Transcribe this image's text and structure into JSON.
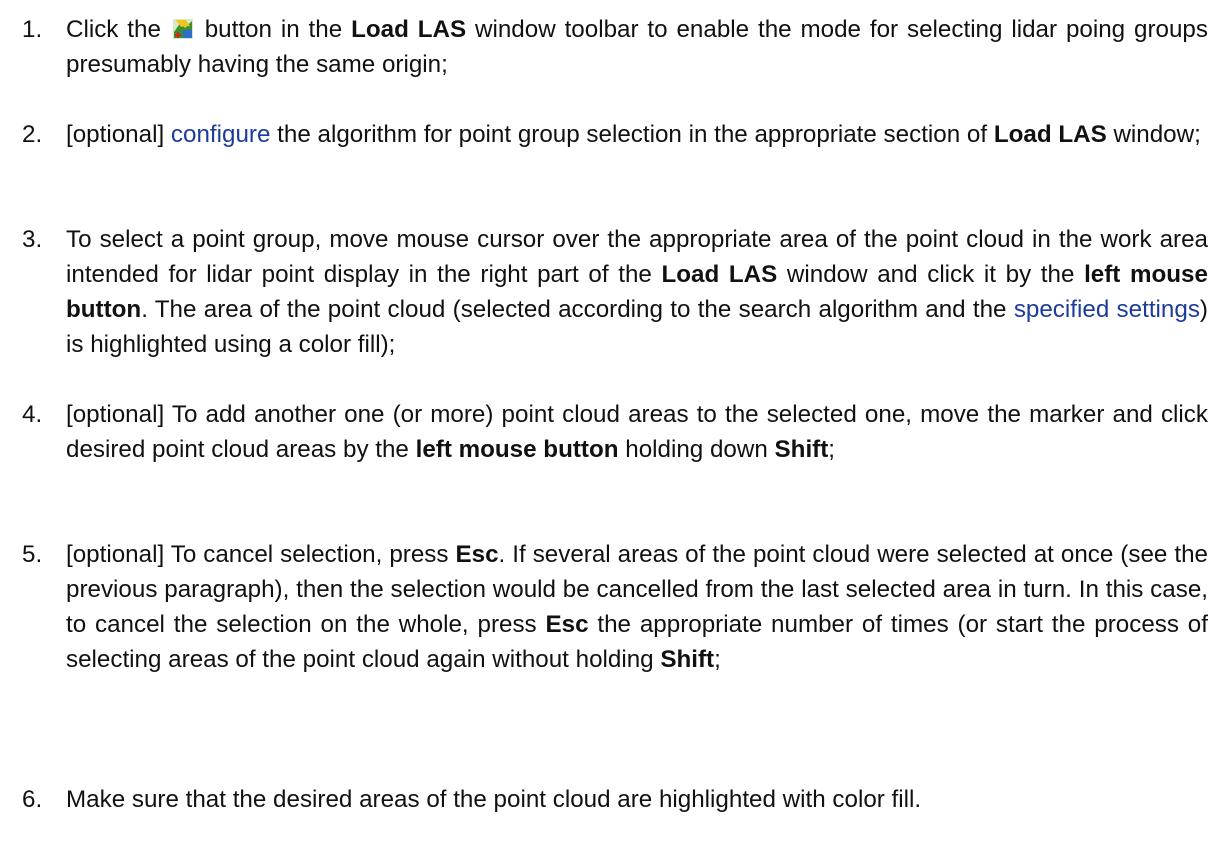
{
  "steps": [
    {
      "number": "1.",
      "parts": {
        "a": "Click the",
        "b": "button in the",
        "c": "Load LAS",
        "d": "window toolbar to enable the mode for selecting lidar poing groups presumably having the same origin;"
      },
      "icon": "select-point-group-toolbar-icon"
    },
    {
      "number": "2.",
      "parts": {
        "a": "[optional]",
        "link": "configure",
        "b": "the algorithm for point group selection in the appropriate section of",
        "c": "Load LAS",
        "d": "window;"
      }
    },
    {
      "number": "3.",
      "parts": {
        "a": "To select a point group, move mouse cursor over the appropriate area of the point cloud in the work area intended for lidar point display in the right part of the",
        "b": "Load LAS",
        "c": "window and click it by the",
        "d": "left mouse button",
        "e": ". The area of the point cloud (selected according to the search algorithm and the",
        "link": "specified settings",
        "f": ") is highlighted using a color fill);"
      }
    },
    {
      "number": "4.",
      "parts": {
        "a": "[optional] To add another one (or more) point cloud areas to the selected one, move the marker and click desired point cloud areas by the",
        "b": "left mouse button",
        "c": "holding down",
        "d": "Shift",
        "e": ";"
      }
    },
    {
      "number": "5.",
      "parts": {
        "a": "[optional] To cancel selection, press",
        "b": "Esc",
        "c": ". If several areas of the point cloud were selected at once (see the previous paragraph), then the selection would be cancelled from the last selected area in turn. In this case, to cancel the selection on the whole, press",
        "d": "Esc",
        "e": "the appropriate number of times (or start the process of selecting areas of the point cloud again without holding",
        "f": "Shift",
        "g": ";"
      }
    },
    {
      "number": "6.",
      "parts": {
        "a": "Make sure that the desired areas of the point cloud are highlighted with color fill."
      }
    }
  ],
  "colors": {
    "link": "#1d3c9a",
    "text": "#111111"
  }
}
